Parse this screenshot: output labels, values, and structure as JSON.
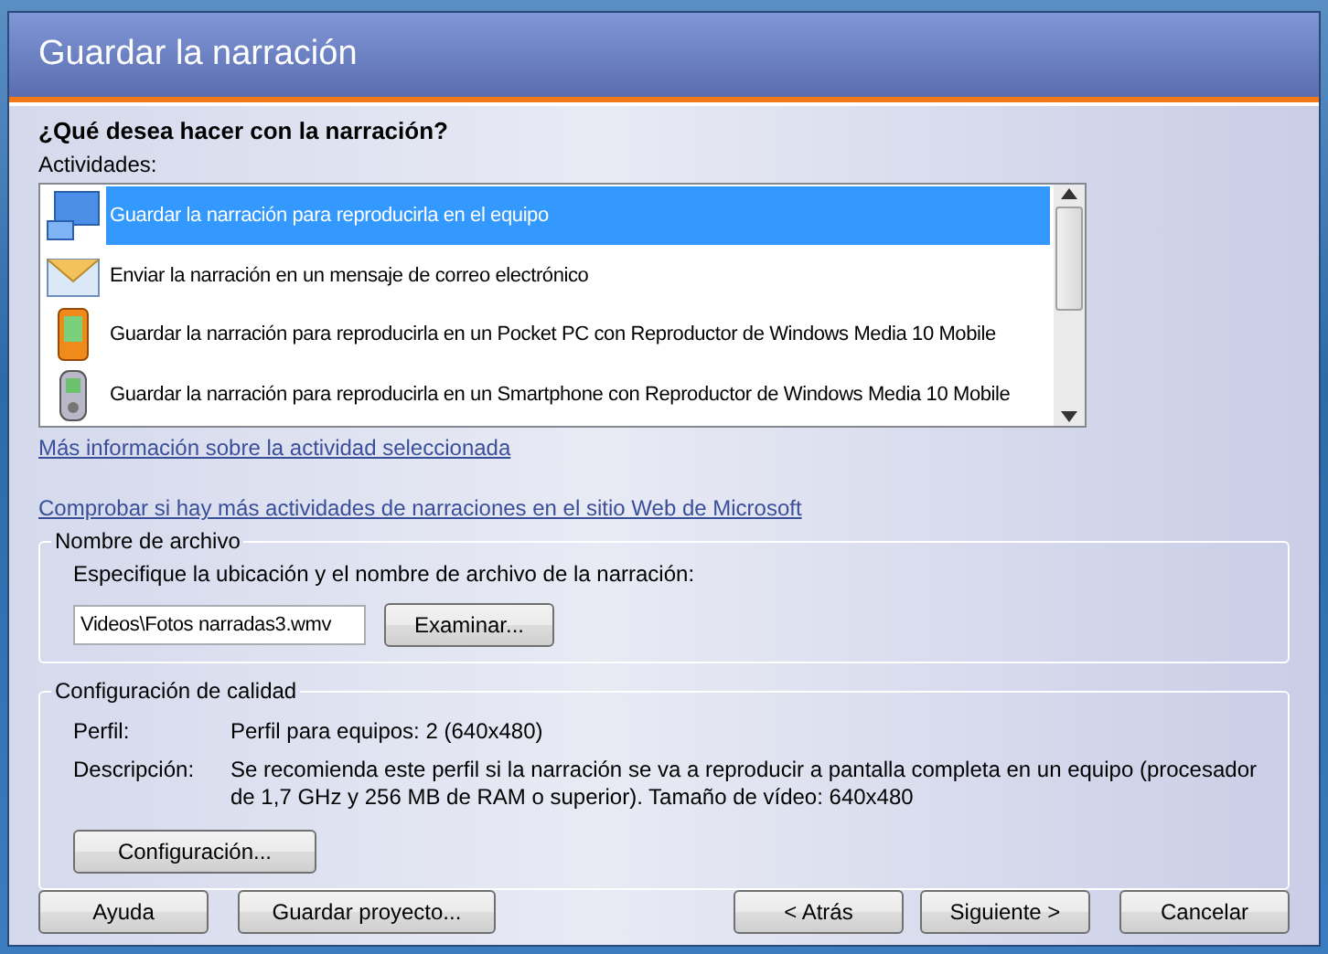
{
  "window": {
    "title": "Guardar la narración"
  },
  "question": "¿Qué desea hacer con la narración?",
  "activities": {
    "label": "Actividades:",
    "items": [
      {
        "kind": "computer",
        "label": "Guardar la narración para reproducirla en el equipo",
        "selected": true
      },
      {
        "kind": "email",
        "label": "Enviar la narración en un mensaje de correo electrónico",
        "selected": false
      },
      {
        "kind": "pocketpc",
        "label": "Guardar la narración para reproducirla en un Pocket PC con Reproductor de Windows Media 10 Mobile",
        "selected": false
      },
      {
        "kind": "smartphone",
        "label": "Guardar la narración para reproducirla en un Smartphone con Reproductor de Windows Media 10 Mobile",
        "selected": false
      }
    ]
  },
  "links": [
    "Más información sobre la actividad seleccionada",
    "Comprobar si hay más actividades de narraciones en el sitio Web de Microsoft"
  ],
  "file": {
    "legend": "Nombre de archivo",
    "prompt": "Especifique la ubicación y el nombre de archivo de la narración:",
    "value": "Videos\\Fotos narradas3.wmv",
    "browse": "Examinar..."
  },
  "quality": {
    "legend": "Configuración de calidad",
    "rows": [
      {
        "label": "Perfil:",
        "value": "Perfil para equipos: 2 (640x480)"
      },
      {
        "label": "Descripción:",
        "value": "Se recomienda este perfil si la narración se va a reproducir a pantalla completa en un equipo (procesador de 1,7 GHz y 256 MB de RAM o superior). Tamaño de vídeo: 640x480"
      }
    ],
    "settings": "Configuración..."
  },
  "buttons_left": [
    "Ayuda",
    "Guardar proyecto..."
  ],
  "buttons_right": [
    "< Atrás",
    "Siguiente >",
    "Cancelar"
  ]
}
